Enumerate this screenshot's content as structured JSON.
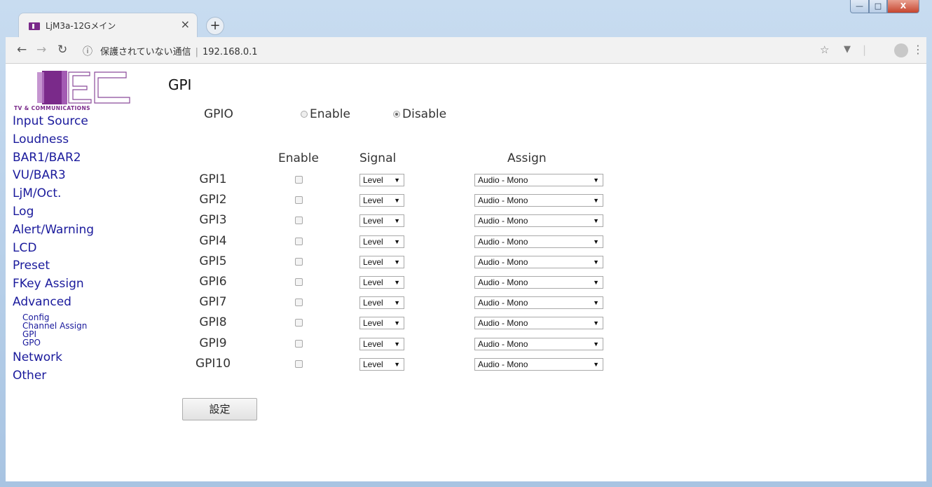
{
  "browser": {
    "tab_title": "LjM3a-12Gメイン",
    "tab_close": "×",
    "new_tab": "+",
    "address_security": "保護されていない通信",
    "address_url": "192.168.0.1"
  },
  "logo": {
    "tagline": "TV & COMMUNICATIONS"
  },
  "sidebar": {
    "items": [
      {
        "label": "Input Source"
      },
      {
        "label": "Loudness"
      },
      {
        "label": "BAR1/BAR2"
      },
      {
        "label": "VU/BAR3"
      },
      {
        "label": "LjM/Oct."
      },
      {
        "label": "Log"
      },
      {
        "label": "Alert/Warning"
      },
      {
        "label": "LCD"
      },
      {
        "label": "Preset"
      },
      {
        "label": "FKey Assign"
      },
      {
        "label": "Advanced"
      }
    ],
    "sub_items": [
      {
        "label": "Config"
      },
      {
        "label": "Channel Assign"
      },
      {
        "label": "GPI"
      },
      {
        "label": "GPO"
      }
    ],
    "items_after": [
      {
        "label": "Network"
      },
      {
        "label": "Other"
      }
    ]
  },
  "main": {
    "title": "GPI",
    "gpio": {
      "label": "GPIO",
      "enable_label": "Enable",
      "disable_label": "Disable",
      "selected": "Disable"
    },
    "columns": {
      "enable": "Enable",
      "signal": "Signal",
      "assign": "Assign"
    },
    "rows": [
      {
        "name": "GPI1",
        "enabled": false,
        "signal": "Level",
        "assign": "Audio - Mono"
      },
      {
        "name": "GPI2",
        "enabled": false,
        "signal": "Level",
        "assign": "Audio - Mono"
      },
      {
        "name": "GPI3",
        "enabled": false,
        "signal": "Level",
        "assign": "Audio - Mono"
      },
      {
        "name": "GPI4",
        "enabled": false,
        "signal": "Level",
        "assign": "Audio - Mono"
      },
      {
        "name": "GPI5",
        "enabled": false,
        "signal": "Level",
        "assign": "Audio - Mono"
      },
      {
        "name": "GPI6",
        "enabled": false,
        "signal": "Level",
        "assign": "Audio - Mono"
      },
      {
        "name": "GPI7",
        "enabled": false,
        "signal": "Level",
        "assign": "Audio - Mono"
      },
      {
        "name": "GPI8",
        "enabled": false,
        "signal": "Level",
        "assign": "Audio - Mono"
      },
      {
        "name": "GPI9",
        "enabled": false,
        "signal": "Level",
        "assign": "Audio - Mono"
      },
      {
        "name": "GPI10",
        "enabled": false,
        "signal": "Level",
        "assign": "Audio - Mono"
      }
    ],
    "submit_label": "設定"
  },
  "colors": {
    "nav_link": "#1a1a9c",
    "logo_purple": "#7a2a8a"
  },
  "icons": {
    "back": "back-arrow-icon",
    "forward": "forward-arrow-icon",
    "reload": "reload-icon",
    "info": "info-icon",
    "bookmark": "star-icon",
    "extension": "extension-icon",
    "profile": "profile-avatar-icon",
    "menu": "kebab-menu-icon"
  }
}
